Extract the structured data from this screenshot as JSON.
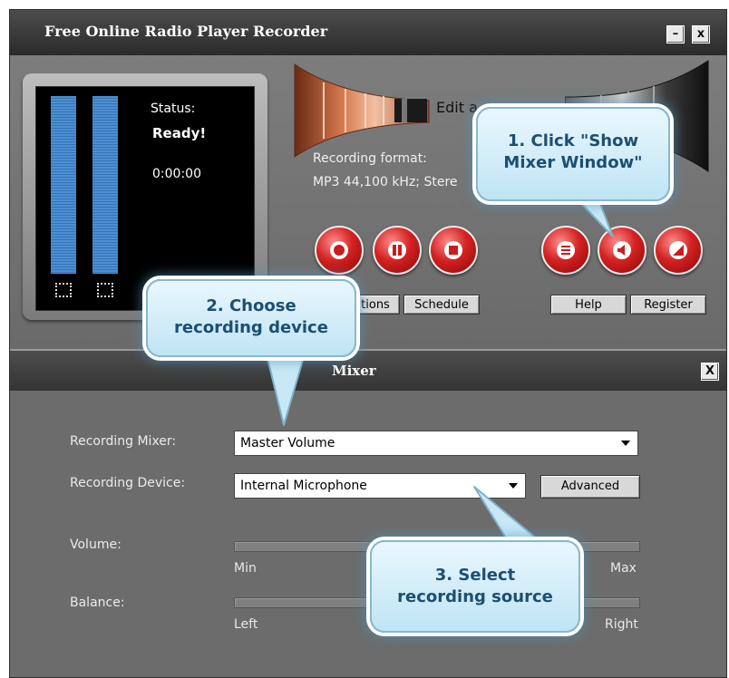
{
  "window": {
    "title": "Free Online Radio Player Recorder"
  },
  "status": {
    "label": "Status:",
    "value": "Ready!",
    "time": "0:00:00"
  },
  "recording": {
    "edit_audio_text": "Edit a",
    "format_label": "Recording format:",
    "format_value": "MP3 44,100 kHz; Stere"
  },
  "transport_buttons": [
    "record-icon",
    "pause-icon",
    "stop-icon"
  ],
  "mixer_buttons": [
    "menu-icon",
    "speaker-icon",
    "edit-icon"
  ],
  "buttons": {
    "options": "tions",
    "schedule": "Schedule",
    "help": "Help",
    "register": "Register"
  },
  "mixer": {
    "title": "Mixer",
    "recording_mixer_label": "Recording Mixer:",
    "recording_mixer_value": "Master Volume",
    "recording_device_label": "Recording Device:",
    "recording_device_value": "Internal Microphone",
    "advanced_label": "Advanced",
    "volume_label": "Volume:",
    "volume_min": "Min",
    "volume_max": "Max",
    "balance_label": "Balance:",
    "balance_left": "Left",
    "balance_right": "Right",
    "volume_level": 0.42,
    "balance_level": 0.5
  },
  "callouts": {
    "step1": [
      "1. Click \"Show",
      "Mixer Window\""
    ],
    "step2": [
      "2. Choose",
      "recording device"
    ],
    "step3": [
      "3. Select",
      "recording source"
    ]
  },
  "colors": {
    "accent_red": "#d42222",
    "meter_blue": "#3d7ec3",
    "callout_text": "#1b4f73"
  }
}
